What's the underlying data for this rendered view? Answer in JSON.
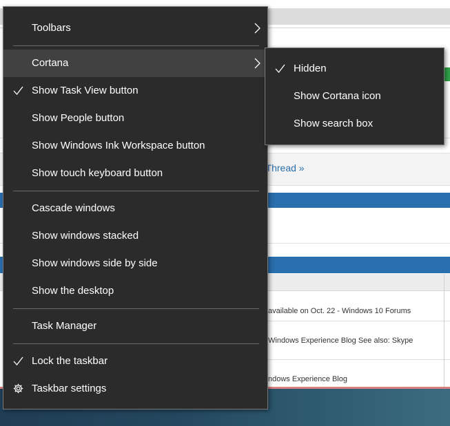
{
  "background": {
    "thread_link": "t Thread »",
    "rows": [
      "available on Oct. 22 - Windows 10 Forums",
      "Windows Experience Blog See also: Skype",
      "ndows Experience Blog"
    ]
  },
  "context_menu": {
    "items": [
      {
        "label": "Toolbars",
        "submenu": true,
        "checked": false
      },
      {
        "label": "Cortana",
        "submenu": true,
        "checked": false,
        "highlighted": true
      },
      {
        "label": "Show Task View button",
        "checked": true
      },
      {
        "label": "Show People button",
        "checked": false
      },
      {
        "label": "Show Windows Ink Workspace button",
        "checked": false
      },
      {
        "label": "Show touch keyboard button",
        "checked": false
      },
      {
        "label": "Cascade windows",
        "checked": false
      },
      {
        "label": "Show windows stacked",
        "checked": false
      },
      {
        "label": "Show windows side by side",
        "checked": false
      },
      {
        "label": "Show the desktop",
        "checked": false
      },
      {
        "label": "Task Manager",
        "checked": false
      },
      {
        "label": "Lock the taskbar",
        "checked": true
      },
      {
        "label": "Taskbar settings",
        "icon": "gear-icon",
        "checked": false
      }
    ]
  },
  "cortana_submenu": {
    "items": [
      {
        "label": "Hidden",
        "checked": true
      },
      {
        "label": "Show Cortana icon",
        "checked": false
      },
      {
        "label": "Show search box",
        "checked": false
      }
    ]
  },
  "colors": {
    "menu_bg": "#2b2b2b",
    "menu_hover": "#414141",
    "menu_text": "#ffffff",
    "link_blue": "#2b6ea8",
    "banner_blue": "#2a6fae"
  }
}
